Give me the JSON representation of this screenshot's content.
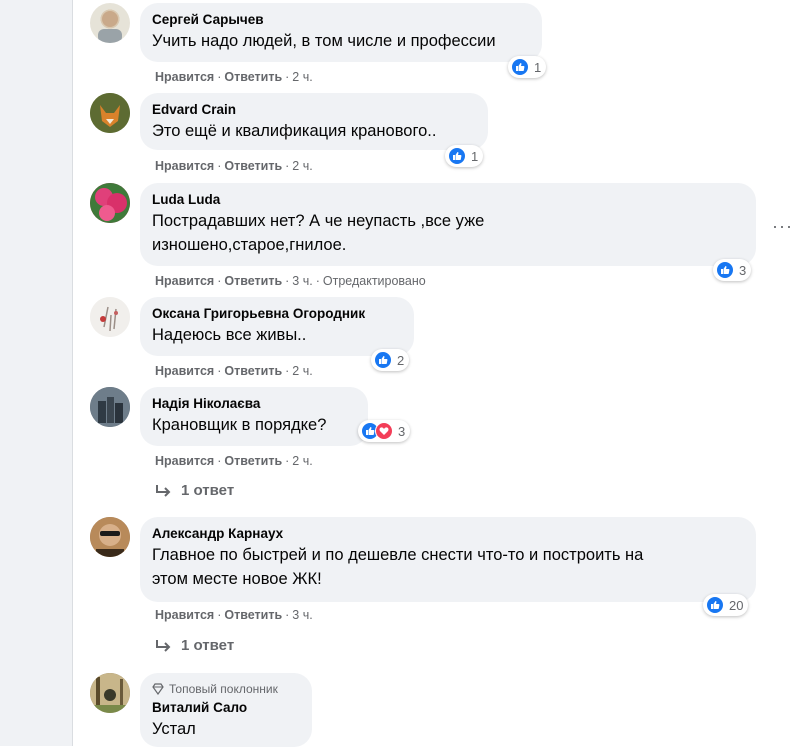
{
  "actions": {
    "like": "Нравится",
    "reply": "Ответить",
    "separator": "·"
  },
  "comments": [
    {
      "author": "Сергей Сарычев",
      "lines": [
        "Учить надо людей, в том числе и профессии"
      ],
      "time": "2 ч.",
      "edited": "",
      "reactions": "1",
      "reaction_types": [
        "like"
      ]
    },
    {
      "author": "Edvard Crain",
      "lines": [
        "Это ещё и квалификация кранового.."
      ],
      "time": "2 ч.",
      "edited": "",
      "reactions": "1",
      "reaction_types": [
        "like"
      ]
    },
    {
      "author": "Luda Luda",
      "lines": [
        "Пострадавших нет? А че неупасть ,все уже",
        "изношено,старое,гнилое."
      ],
      "time": "3 ч.",
      "edited": "Отредактировано",
      "reactions": "3",
      "reaction_types": [
        "like"
      ]
    },
    {
      "author": "Оксана Григорьевна Огородник",
      "lines": [
        "Надеюсь все живы.."
      ],
      "time": "2 ч.",
      "edited": "",
      "reactions": "2",
      "reaction_types": [
        "like"
      ]
    },
    {
      "author": "Надія Ніколаєва",
      "lines": [
        "Крановщик в порядке?"
      ],
      "time": "2 ч.",
      "edited": "",
      "reactions": "3",
      "reaction_types": [
        "like",
        "love"
      ],
      "replies": "1 ответ"
    },
    {
      "author": "Александр Карнаух",
      "lines": [
        "Главное по быстрей и по дешевле снести что-то и построить на",
        "этом месте новое ЖК!"
      ],
      "time": "3 ч.",
      "edited": "",
      "reactions": "20",
      "reaction_types": [
        "like"
      ],
      "replies": "1 ответ"
    },
    {
      "author": "Виталий Сало",
      "badge": "Топовый поклонник",
      "lines": [
        "Устал"
      ]
    }
  ],
  "more_options": "···",
  "colors": {
    "like": "#1877f2",
    "love": "#f33e58",
    "bubble": "#f0f2f5",
    "meta": "#65676b"
  }
}
